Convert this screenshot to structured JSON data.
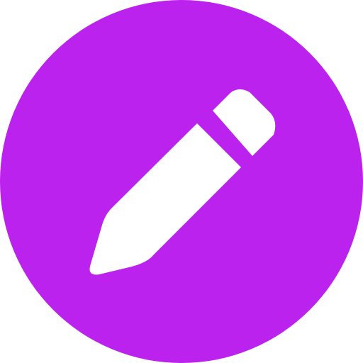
{
  "icon": {
    "name": "pencil-icon",
    "action": "edit",
    "colors": {
      "background": "#bb22ee",
      "glyph": "#ffffff"
    }
  }
}
